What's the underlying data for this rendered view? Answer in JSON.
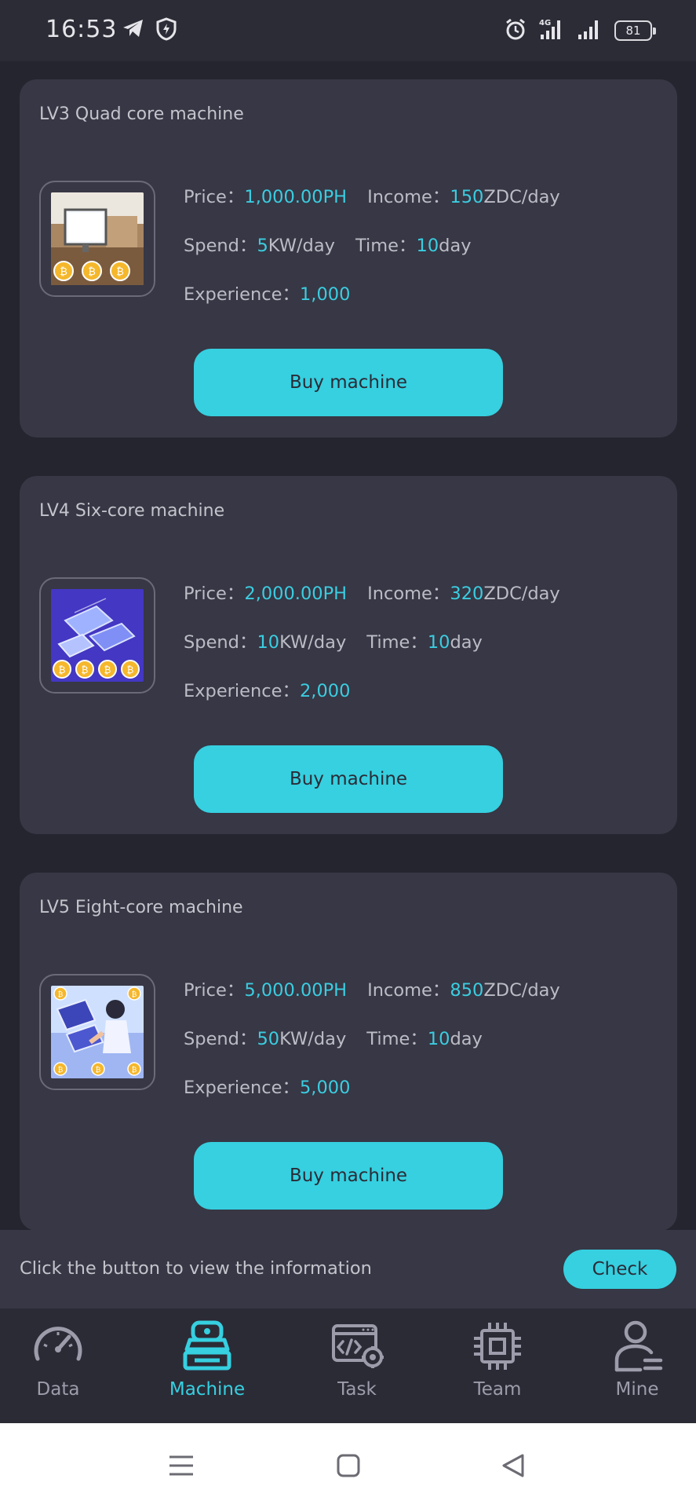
{
  "status_bar": {
    "time": "16:53",
    "icons_left": [
      "telegram-icon",
      "shield-icon"
    ],
    "icons_right": [
      "alarm-icon",
      "signal-4g-icon",
      "signal-icon",
      "battery-icon"
    ],
    "battery_level": "81"
  },
  "machines": [
    {
      "title": "LV3 Quad core machine",
      "image": "office-monitor-bitcoin-image",
      "price_label": "Price：",
      "price_value": "1,000.00PH",
      "income_label": "Income：",
      "income_value": "150",
      "income_unit": "ZDC/day",
      "spend_label": "Spend：",
      "spend_value": "5",
      "spend_unit": "KW/day",
      "time_label": "Time：",
      "time_value": "10",
      "time_unit": "day",
      "experience_label": "Experience：",
      "experience_value": "1,000",
      "button": "Buy machine"
    },
    {
      "title": "LV4 Six-core machine",
      "image": "laptops-bitcoin-image",
      "price_label": "Price：",
      "price_value": "2,000.00PH",
      "income_label": "Income：",
      "income_value": "320",
      "income_unit": "ZDC/day",
      "spend_label": "Spend：",
      "spend_value": "10",
      "spend_unit": "KW/day",
      "time_label": "Time：",
      "time_value": "10",
      "time_unit": "day",
      "experience_label": "Experience：",
      "experience_value": "2,000",
      "button": "Buy machine"
    },
    {
      "title": "LV5 Eight-core machine",
      "image": "person-computers-bitcoin-image",
      "price_label": "Price：",
      "price_value": "5,000.00PH",
      "income_label": "Income：",
      "income_value": "850",
      "income_unit": "ZDC/day",
      "spend_label": "Spend：",
      "spend_value": "50",
      "spend_unit": "KW/day",
      "time_label": "Time：",
      "time_value": "10",
      "time_unit": "day",
      "experience_label": "Experience：",
      "experience_value": "5,000",
      "button": "Buy machine"
    }
  ],
  "info_bar": {
    "text": "Click the button to view the information",
    "button": "Check"
  },
  "tabs": [
    {
      "label": "Data",
      "icon": "speedometer-icon",
      "active": false
    },
    {
      "label": "Machine",
      "icon": "machine-icon",
      "active": true
    },
    {
      "label": "Task",
      "icon": "task-code-icon",
      "active": false
    },
    {
      "label": "Team",
      "icon": "chip-icon",
      "active": false
    },
    {
      "label": "Mine",
      "icon": "user-icon",
      "active": false
    }
  ],
  "nav": [
    "menu-icon",
    "home-icon",
    "back-icon"
  ],
  "colors": {
    "background": "#25252f",
    "card": "#373745",
    "accent": "#36d0e0",
    "tab_inactive": "#9c9cab"
  }
}
